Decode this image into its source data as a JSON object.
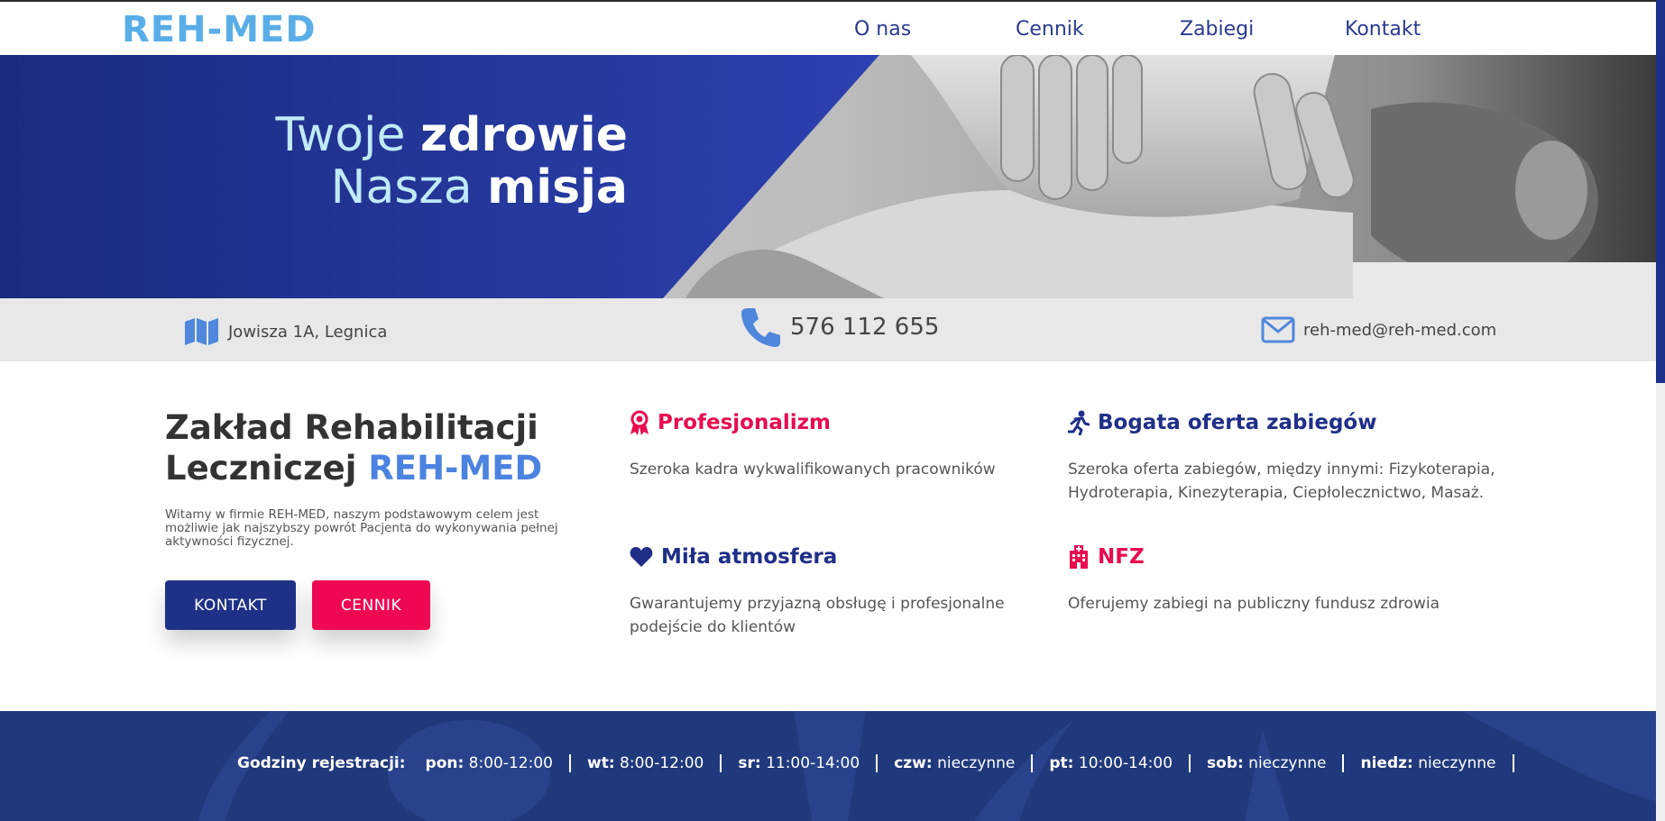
{
  "brand": {
    "logo_text": "REH-MED"
  },
  "nav": {
    "items": [
      "O nas",
      "Cennik",
      "Zabiegi",
      "Kontakt"
    ]
  },
  "hero": {
    "line1_light": "Twoje ",
    "line1_bold": "zdrowie",
    "line2_light": "Nasza ",
    "line2_bold": "misja"
  },
  "contact": {
    "address": "Jowisza 1A, Legnica",
    "phone": "576 112 655",
    "email": "reh-med@reh-med.com"
  },
  "intro": {
    "title_part1": "Zakład Rehabilitacji Leczniczej ",
    "title_accent": "REH-MED",
    "description": "Witamy w firmie REH-MED, naszym podstawowym celem jest możliwie jak najszybszy powrót Pacjenta do wykonywania pełnej aktywności fizycznej.",
    "btn_kontakt": "KONTAKT",
    "btn_cennik": "CENNIK"
  },
  "features": [
    {
      "title": "Profesjonalizm",
      "desc": "Szeroka kadra wykwalifikowanych pracowników",
      "icon": "award-icon",
      "color": "#e80c50"
    },
    {
      "title": "Bogata oferta zabiegów",
      "desc": "Szeroka oferta zabiegów, między innymi: Fizykoterapia, Hydroterapia, Kinezyterapia, Ciepłolecznictwo, Masaż.",
      "icon": "running-icon",
      "color": "#1f2f88"
    },
    {
      "title": "Miła atmosfera",
      "desc": "Gwarantujemy przyjazną obsługę i profesjonalne podejście do klientów",
      "icon": "heart-icon",
      "color": "#1f2f88"
    },
    {
      "title": "NFZ",
      "desc": "Oferujemy zabiegi na publiczny fundusz zdrowia",
      "icon": "hospital-icon",
      "color": "#e80c50"
    }
  ],
  "hours": {
    "label": "Godziny rejestracji:",
    "days": [
      {
        "day": "pon:",
        "time": " 8:00-12:00"
      },
      {
        "day": "wt:",
        "time": " 8:00-12:00"
      },
      {
        "day": "sr:",
        "time": " 11:00-14:00"
      },
      {
        "day": "czw:",
        "time": " nieczynne"
      },
      {
        "day": "pt:",
        "time": " 10:00-14:00"
      },
      {
        "day": "sob:",
        "time": " nieczynne"
      },
      {
        "day": "niedz:",
        "time": " nieczynne"
      }
    ]
  },
  "colors": {
    "navy": "#1f3187",
    "pink": "#ef0852",
    "accent_blue": "#4c83e0",
    "logo_blue": "#5aaee8"
  }
}
